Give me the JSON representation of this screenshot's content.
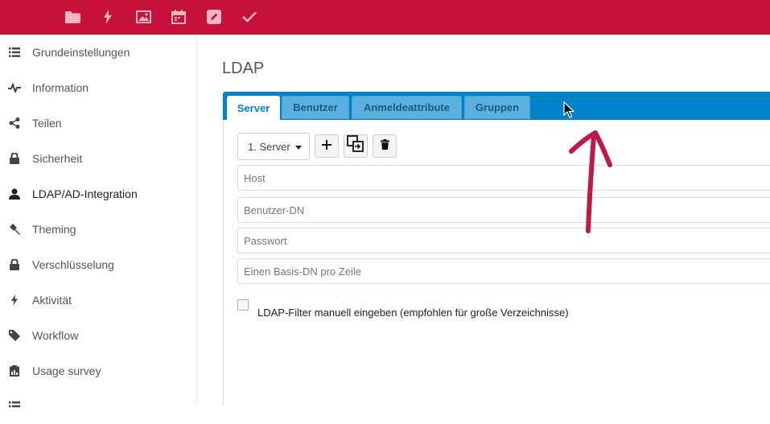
{
  "header": {
    "apps": [
      {
        "name": "files-icon",
        "label": "Dateien"
      },
      {
        "name": "activity-icon",
        "label": "Aktivität"
      },
      {
        "name": "gallery-icon",
        "label": "Galerie"
      },
      {
        "name": "calendar-icon",
        "label": "Kalender"
      },
      {
        "name": "notes-icon",
        "label": "Notizen"
      },
      {
        "name": "tasks-icon",
        "label": "Aufgaben"
      }
    ],
    "bg_color": "#c6113a"
  },
  "sidebar": {
    "items": [
      {
        "label": "Grundeinstellungen",
        "icon": "list-icon"
      },
      {
        "label": "Information",
        "icon": "pulse-icon"
      },
      {
        "label": "Teilen",
        "icon": "share-icon"
      },
      {
        "label": "Sicherheit",
        "icon": "lock-icon"
      },
      {
        "label": "LDAP/AD-Integration",
        "icon": "user-icon"
      },
      {
        "label": "Theming",
        "icon": "brush-icon"
      },
      {
        "label": "Verschlüsselung",
        "icon": "lock-icon"
      },
      {
        "label": "Aktivität",
        "icon": "lightning-icon"
      },
      {
        "label": "Workflow",
        "icon": "tag-icon"
      },
      {
        "label": "Usage survey",
        "icon": "survey-icon"
      }
    ],
    "active": "LDAP/AD-Integration"
  },
  "main": {
    "title": "LDAP",
    "tabs": [
      {
        "label": "Server",
        "active": true
      },
      {
        "label": "Benutzer",
        "active": false
      },
      {
        "label": "Anmeldeattribute",
        "active": false
      },
      {
        "label": "Gruppen",
        "active": false
      }
    ],
    "server_select": {
      "value": "1. Server"
    },
    "toolbar": {
      "add_icon": "plus-icon",
      "copy_icon": "copy-icon",
      "delete_icon": "trash-icon"
    },
    "fields": {
      "host_placeholder": "Host",
      "user_dn_placeholder": "Benutzer-DN",
      "password_placeholder": "Passwort",
      "base_dn_placeholder": "Einen Basis-DN pro Zeile"
    },
    "ldap_filter_label": "LDAP-Filter manuell eingeben (empfohlen für große Verzeichnisse)",
    "accent_color": "#0082c9"
  }
}
